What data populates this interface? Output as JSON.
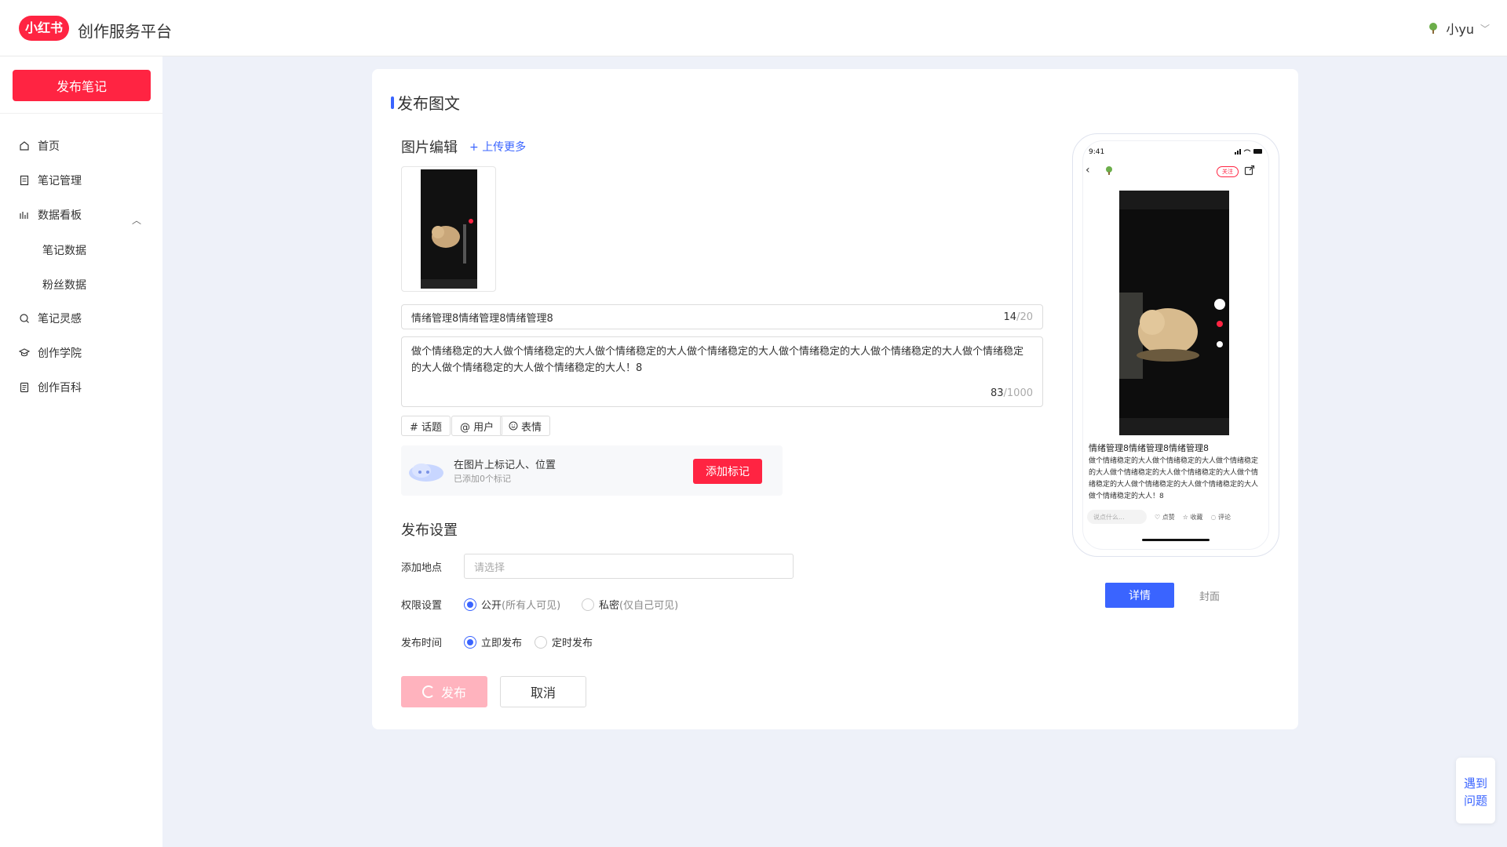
{
  "header": {
    "logo_text": "小红书",
    "app_title": "创作服务平台",
    "user_name": "小yu"
  },
  "sidebar": {
    "publish_label": "发布笔记",
    "items": [
      {
        "label": "首页",
        "icon": "home-icon"
      },
      {
        "label": "笔记管理",
        "icon": "note-icon"
      },
      {
        "label": "数据看板",
        "icon": "chart-icon"
      },
      {
        "label": "笔记数据",
        "icon": ""
      },
      {
        "label": "粉丝数据",
        "icon": ""
      },
      {
        "label": "笔记灵感",
        "icon": "inspiration-icon"
      },
      {
        "label": "创作学院",
        "icon": "academy-icon"
      },
      {
        "label": "创作百科",
        "icon": "wiki-icon"
      }
    ]
  },
  "main": {
    "page_title": "发布图文",
    "image_edit_label": "图片编辑",
    "upload_more": "上传更多",
    "title_value": "情绪管理8情绪管理8情绪管理8",
    "title_count": "14",
    "title_max": "/20",
    "desc_value": "做个情绪稳定的大人做个情绪稳定的大人做个情绪稳定的大人做个情绪稳定的大人做个情绪稳定的大人做个情绪稳定的大人做个情绪稳定的大人做个情绪稳定的大人做个情绪稳定的大人！8",
    "desc_count": "83",
    "desc_max": "/1000",
    "chips": [
      "# 话题",
      "@ 用户",
      "表情"
    ],
    "tag_panel": {
      "main": "在图片上标记人、位置",
      "sub": "已添加0个标记",
      "button": "添加标记"
    },
    "settings_title": "发布设置",
    "location_label": "添加地点",
    "location_placeholder": "请选择",
    "permission_label": "权限设置",
    "permission_public": "公开",
    "permission_public_note": "(所有人可见)",
    "permission_private": "私密",
    "permission_private_note": "(仅自己可见)",
    "time_label": "发布时间",
    "time_now": "立即发布",
    "time_scheduled": "定时发布",
    "submit_label": "发布",
    "cancel_label": "取消"
  },
  "preview": {
    "status_time": "9:41",
    "follow_label": "关注",
    "note_title": "情绪管理8情绪管理8情绪管理8",
    "note_desc": "做个情绪稳定的大人做个情绪稳定的大人做个情绪稳定的大人做个情绪稳定的大人做个情绪稳定的大人做个情绪稳定的大人做个情绪稳定的大人做个情绪稳定的大人做个情绪稳定的大人！8",
    "comment_placeholder": "说点什么...",
    "like_label": "点赞",
    "collect_label": "收藏",
    "comment_label": "评论",
    "tab_detail": "详情",
    "tab_cover": "封面"
  },
  "help": {
    "line1": "遇到",
    "line2": "问题"
  },
  "colors": {
    "brand_red": "#ff2442",
    "accent_blue": "#3a64ff",
    "background": "#eef1f9"
  }
}
